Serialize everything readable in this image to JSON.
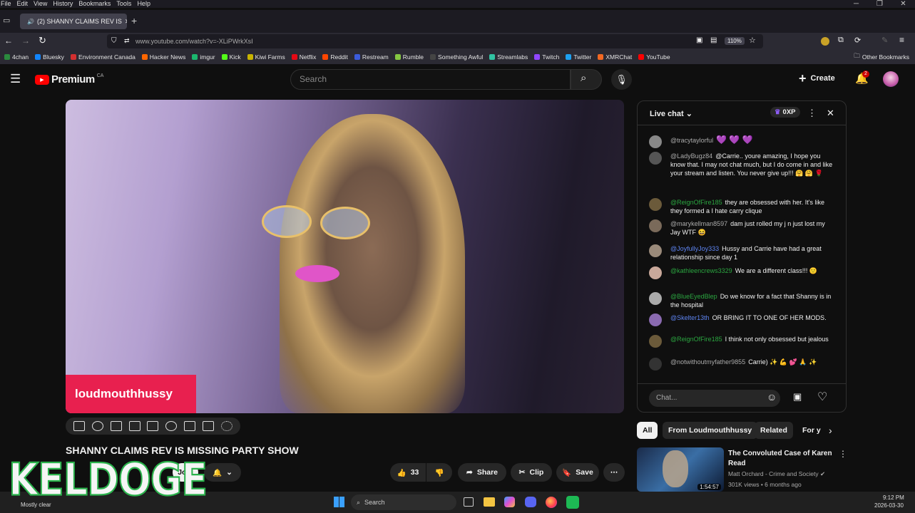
{
  "menubar": {
    "items": [
      "File",
      "Edit",
      "View",
      "History",
      "Bookmarks",
      "Tools",
      "Help"
    ]
  },
  "tab": {
    "title": "(2) SHANNY CLAIMS REV IS"
  },
  "nav": {
    "url": "www.youtube.com/watch?v=-XLiPWrkXsI",
    "zoom": "110%"
  },
  "bookmarks": [
    {
      "label": "4chan",
      "color": "#2b8a3e"
    },
    {
      "label": "Bluesky",
      "color": "#1185fe"
    },
    {
      "label": "Environment Canada",
      "color": "#d32f2f"
    },
    {
      "label": "Hacker News",
      "color": "#ff6600"
    },
    {
      "label": "imgur",
      "color": "#1bb76e"
    },
    {
      "label": "Kick",
      "color": "#53fc18"
    },
    {
      "label": "Kiwi Farms",
      "color": "#c8b400"
    },
    {
      "label": "Netflix",
      "color": "#e50914"
    },
    {
      "label": "Reddit",
      "color": "#ff4500"
    },
    {
      "label": "Restream",
      "color": "#3b5bdb"
    },
    {
      "label": "Rumble",
      "color": "#85c742"
    },
    {
      "label": "Something Awful",
      "color": "#444444"
    },
    {
      "label": "Streamlabs",
      "color": "#31c3a2"
    },
    {
      "label": "Twitch",
      "color": "#9146ff"
    },
    {
      "label": "Twitter",
      "color": "#1da1f2"
    },
    {
      "label": "XMRChat",
      "color": "#f26822"
    },
    {
      "label": "YouTube",
      "color": "#ff0000"
    }
  ],
  "other_bookmarks": "Other Bookmarks",
  "yt": {
    "brand": "Premium",
    "region": "CA",
    "search_placeholder": "Search",
    "create_label": "Create",
    "notif_count": "2"
  },
  "video": {
    "overlay_name": "loudmouthhussy",
    "title": "SHANNY CLAIMS REV IS MISSING PARTY SHOW",
    "join_label": "Join",
    "likes": "33",
    "share_label": "Share",
    "clip_label": "Clip",
    "save_label": "Save"
  },
  "chat": {
    "title": "Live chat",
    "xp": "0XP",
    "input_placeholder": "Chat...",
    "messages": [
      {
        "author": "@tracytaylorful",
        "text": "💜 💜 💜",
        "type": "normal"
      },
      {
        "author": "@LadyBugz84",
        "text": "@Carrie.. youre amazing, I hope you know that. I may not chat much, but I do come in and like your stream and listen. You never give up!!! 🤗 🤗 🌹",
        "type": "normal"
      },
      {
        "author": "@ReignOfFire185",
        "text": "they are obsessed with her. It's like they formed a I hate carry clique",
        "type": "mem"
      },
      {
        "author": "@marykellman8597",
        "text": "dam just rolled my j n just lost my Jay WTF 😆",
        "type": "normal"
      },
      {
        "author": "@JoyfullyJoy333",
        "text": "Hussy and Carrie have had a great relationship since day 1",
        "type": "mod"
      },
      {
        "author": "@kathleencrews3329",
        "text": "We are a different class!!! 🙂",
        "type": "mem"
      },
      {
        "author": "@BlueEyedBlep",
        "text": "Do we know for a fact that Shanny is in the hospital",
        "type": "mem"
      },
      {
        "author": "@Skelter13th",
        "text": "OR BRING IT TO ONE OF HER MODS.",
        "type": "mod"
      },
      {
        "author": "@ReignOfFire185",
        "text": "I think not only obsessed but jealous",
        "type": "mem"
      },
      {
        "author": "@notwithoutmyfather9855",
        "text": "Carrie) ✨ 💪 💕 🙏 ✨",
        "type": "normal"
      }
    ]
  },
  "chips": [
    "All",
    "From Loudmouthhussy",
    "Related",
    "For y"
  ],
  "recommendation": {
    "title": "The Convoluted Case of Karen Read",
    "channel": "Matt Orchard - Crime and Society",
    "meta": "301K views • 6 months ago",
    "duration": "1:54:57"
  },
  "watermark": "KELDOGE",
  "taskbar": {
    "weather": "Mostly clear",
    "search_label": "Search",
    "time": "9:12 PM",
    "date": "2026-03-30"
  }
}
